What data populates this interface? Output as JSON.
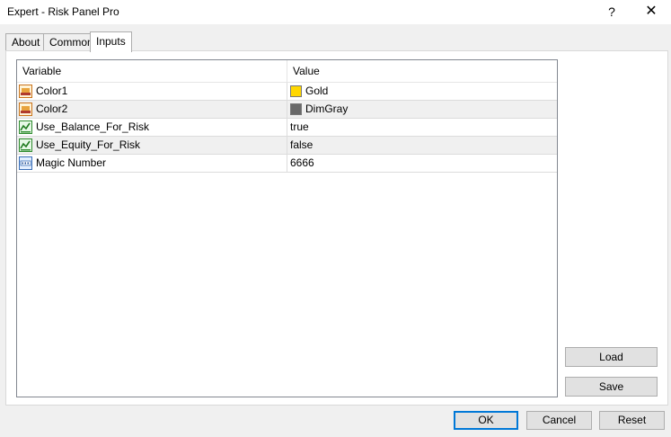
{
  "window": {
    "title": "Expert - Risk Panel Pro",
    "help_glyph": "?",
    "close_glyph": "✕"
  },
  "tabs": [
    {
      "label": "About"
    },
    {
      "label": "Common"
    },
    {
      "label": "Inputs",
      "active": true
    }
  ],
  "grid": {
    "headers": {
      "variable": "Variable",
      "value": "Value"
    },
    "rows": [
      {
        "icon": "color-param-icon",
        "name": "Color1",
        "value": "Gold",
        "swatch": "#FFD700"
      },
      {
        "icon": "color-param-icon",
        "name": "Color2",
        "value": "DimGray",
        "swatch": "#696969"
      },
      {
        "icon": "bool-param-icon",
        "name": "Use_Balance_For_Risk",
        "value": "true"
      },
      {
        "icon": "bool-param-icon",
        "name": "Use_Equity_For_Risk",
        "value": "false"
      },
      {
        "icon": "int-param-icon",
        "name": "Magic Number",
        "value": "6666"
      }
    ]
  },
  "side_buttons": {
    "load": "Load",
    "save": "Save"
  },
  "footer_buttons": {
    "ok": "OK",
    "cancel": "Cancel",
    "reset": "Reset"
  },
  "colors": {
    "accent": "#0078D7",
    "gold": "#FFD700",
    "dimgray": "#696969"
  }
}
